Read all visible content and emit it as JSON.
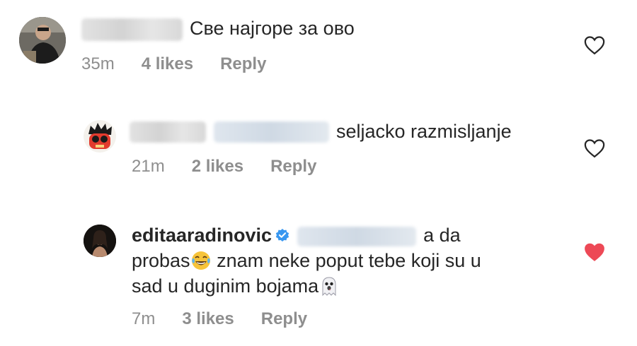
{
  "comments": [
    {
      "text": "Све најгоре за ово",
      "time": "35m",
      "likes": "4 likes",
      "reply": "Reply",
      "liked": false
    },
    {
      "text": "seljacko razmisljanje",
      "time": "21m",
      "likes": "2 likes",
      "reply": "Reply",
      "liked": false
    },
    {
      "username": "editaaradinovic",
      "text_part1": "a da",
      "text_part2": "probas",
      "text_part3": " znam neke poput tebe koji su u",
      "text_part4": "sad u duginim bojama",
      "time": "7m",
      "likes": "3 likes",
      "reply": "Reply",
      "liked": true
    }
  ],
  "colors": {
    "text": "#262626",
    "meta": "#8e8e8e",
    "heart_liked": "#ed4956",
    "verified": "#3897f0"
  }
}
